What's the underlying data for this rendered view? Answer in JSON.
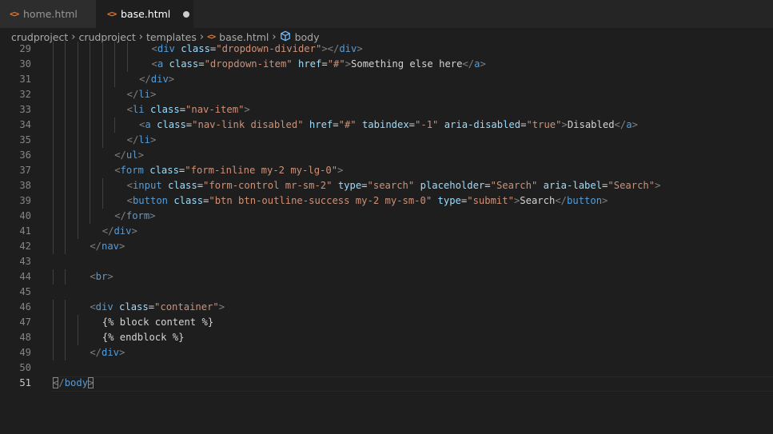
{
  "tabs": [
    {
      "icon": "html-file-icon",
      "label": "home.html",
      "active": false,
      "dirty": false
    },
    {
      "icon": "html-file-icon",
      "label": "base.html",
      "active": true,
      "dirty": true
    }
  ],
  "breadcrumb": [
    "crudproject",
    "crudproject",
    "templates",
    "base.html",
    "body"
  ],
  "colors": {
    "background": "#1e1e1e",
    "tag": "#569cd6",
    "punctuation": "#808080",
    "attribute": "#9cdcfe",
    "string": "#ce9178",
    "text": "#d4d4d4",
    "html_icon": "#e37933",
    "symbol_icon": "#75beff"
  },
  "editor": {
    "current_line": 51,
    "lines": [
      {
        "num": "29",
        "indent": 8,
        "tokens": [
          [
            "br",
            "<"
          ],
          [
            "tag",
            "div"
          ],
          [
            "text",
            " "
          ],
          [
            "attr",
            "class"
          ],
          [
            "text",
            "="
          ],
          [
            "str",
            "\"dropdown-divider\""
          ],
          [
            "br",
            "></"
          ],
          [
            "tag",
            "div"
          ],
          [
            "br",
            ">"
          ]
        ]
      },
      {
        "num": "30",
        "indent": 8,
        "tokens": [
          [
            "br",
            "<"
          ],
          [
            "tag",
            "a"
          ],
          [
            "text",
            " "
          ],
          [
            "attr",
            "class"
          ],
          [
            "text",
            "="
          ],
          [
            "str",
            "\"dropdown-item\""
          ],
          [
            "text",
            " "
          ],
          [
            "attr",
            "href"
          ],
          [
            "text",
            "="
          ],
          [
            "str",
            "\"#\""
          ],
          [
            "br",
            ">"
          ],
          [
            "text",
            "Something else here"
          ],
          [
            "br",
            "</"
          ],
          [
            "tag",
            "a"
          ],
          [
            "br",
            ">"
          ]
        ]
      },
      {
        "num": "31",
        "indent": 7,
        "tokens": [
          [
            "br",
            "</"
          ],
          [
            "tag",
            "div"
          ],
          [
            "br",
            ">"
          ]
        ]
      },
      {
        "num": "32",
        "indent": 6,
        "tokens": [
          [
            "br",
            "</"
          ],
          [
            "tag",
            "li"
          ],
          [
            "br",
            ">"
          ]
        ]
      },
      {
        "num": "33",
        "indent": 6,
        "tokens": [
          [
            "br",
            "<"
          ],
          [
            "tag",
            "li"
          ],
          [
            "text",
            " "
          ],
          [
            "attr",
            "class"
          ],
          [
            "text",
            "="
          ],
          [
            "str",
            "\"nav-item\""
          ],
          [
            "br",
            ">"
          ]
        ]
      },
      {
        "num": "34",
        "indent": 7,
        "tokens": [
          [
            "br",
            "<"
          ],
          [
            "tag",
            "a"
          ],
          [
            "text",
            " "
          ],
          [
            "attr",
            "class"
          ],
          [
            "text",
            "="
          ],
          [
            "str",
            "\"nav-link disabled\""
          ],
          [
            "text",
            " "
          ],
          [
            "attr",
            "href"
          ],
          [
            "text",
            "="
          ],
          [
            "str",
            "\"#\""
          ],
          [
            "text",
            " "
          ],
          [
            "attr",
            "tabindex"
          ],
          [
            "text",
            "="
          ],
          [
            "str",
            "\"-1\""
          ],
          [
            "text",
            " "
          ],
          [
            "attr",
            "aria-disabled"
          ],
          [
            "text",
            "="
          ],
          [
            "str",
            "\"true\""
          ],
          [
            "br",
            ">"
          ],
          [
            "text",
            "Disabled"
          ],
          [
            "br",
            "</"
          ],
          [
            "tag",
            "a"
          ],
          [
            "br",
            ">"
          ]
        ]
      },
      {
        "num": "35",
        "indent": 6,
        "tokens": [
          [
            "br",
            "</"
          ],
          [
            "tag",
            "li"
          ],
          [
            "br",
            ">"
          ]
        ]
      },
      {
        "num": "36",
        "indent": 5,
        "tokens": [
          [
            "br",
            "</"
          ],
          [
            "tag",
            "ul"
          ],
          [
            "br",
            ">"
          ]
        ]
      },
      {
        "num": "37",
        "indent": 5,
        "tokens": [
          [
            "br",
            "<"
          ],
          [
            "tag",
            "form"
          ],
          [
            "text",
            " "
          ],
          [
            "attr",
            "class"
          ],
          [
            "text",
            "="
          ],
          [
            "str",
            "\"form-inline my-2 my-lg-0\""
          ],
          [
            "br",
            ">"
          ]
        ]
      },
      {
        "num": "38",
        "indent": 6,
        "tokens": [
          [
            "br",
            "<"
          ],
          [
            "tag",
            "input"
          ],
          [
            "text",
            " "
          ],
          [
            "attr",
            "class"
          ],
          [
            "text",
            "="
          ],
          [
            "str",
            "\"form-control mr-sm-2\""
          ],
          [
            "text",
            " "
          ],
          [
            "attr",
            "type"
          ],
          [
            "text",
            "="
          ],
          [
            "str",
            "\"search\""
          ],
          [
            "text",
            " "
          ],
          [
            "attr",
            "placeholder"
          ],
          [
            "text",
            "="
          ],
          [
            "str",
            "\"Search\""
          ],
          [
            "text",
            " "
          ],
          [
            "attr",
            "aria-label"
          ],
          [
            "text",
            "="
          ],
          [
            "str",
            "\"Search\""
          ],
          [
            "br",
            ">"
          ]
        ]
      },
      {
        "num": "39",
        "indent": 6,
        "tokens": [
          [
            "br",
            "<"
          ],
          [
            "tag",
            "button"
          ],
          [
            "text",
            " "
          ],
          [
            "attr",
            "class"
          ],
          [
            "text",
            "="
          ],
          [
            "str",
            "\"btn btn-outline-success my-2 my-sm-0\""
          ],
          [
            "text",
            " "
          ],
          [
            "attr",
            "type"
          ],
          [
            "text",
            "="
          ],
          [
            "str",
            "\"submit\""
          ],
          [
            "br",
            ">"
          ],
          [
            "text",
            "Search"
          ],
          [
            "br",
            "</"
          ],
          [
            "tag",
            "button"
          ],
          [
            "br",
            ">"
          ]
        ]
      },
      {
        "num": "40",
        "indent": 5,
        "tokens": [
          [
            "br",
            "</"
          ],
          [
            "tag",
            "form"
          ],
          [
            "br",
            ">"
          ]
        ]
      },
      {
        "num": "41",
        "indent": 4,
        "tokens": [
          [
            "br",
            "</"
          ],
          [
            "tag",
            "div"
          ],
          [
            "br",
            ">"
          ]
        ]
      },
      {
        "num": "42",
        "indent": 3,
        "tokens": [
          [
            "br",
            "</"
          ],
          [
            "tag",
            "nav"
          ],
          [
            "br",
            ">"
          ]
        ]
      },
      {
        "num": "43",
        "indent": 0,
        "tokens": []
      },
      {
        "num": "44",
        "indent": 3,
        "tokens": [
          [
            "br",
            "<"
          ],
          [
            "tag",
            "br"
          ],
          [
            "br",
            ">"
          ]
        ]
      },
      {
        "num": "45",
        "indent": 0,
        "tokens": []
      },
      {
        "num": "46",
        "indent": 3,
        "tokens": [
          [
            "br",
            "<"
          ],
          [
            "tag",
            "div"
          ],
          [
            "text",
            " "
          ],
          [
            "attr",
            "class"
          ],
          [
            "text",
            "="
          ],
          [
            "str",
            "\"container\""
          ],
          [
            "br",
            ">"
          ]
        ]
      },
      {
        "num": "47",
        "indent": 4,
        "tokens": [
          [
            "text",
            "{% block content %}"
          ]
        ]
      },
      {
        "num": "48",
        "indent": 4,
        "tokens": [
          [
            "text",
            "{% endblock %}"
          ]
        ]
      },
      {
        "num": "49",
        "indent": 3,
        "tokens": [
          [
            "br",
            "</"
          ],
          [
            "tag",
            "div"
          ],
          [
            "br",
            ">"
          ]
        ]
      },
      {
        "num": "50",
        "indent": 0,
        "tokens": []
      },
      {
        "num": "51",
        "indent": 0,
        "tokens": [
          [
            "brm",
            "<"
          ],
          [
            "br",
            "/"
          ],
          [
            "tag",
            "body"
          ],
          [
            "brm",
            ">"
          ]
        ]
      }
    ]
  }
}
